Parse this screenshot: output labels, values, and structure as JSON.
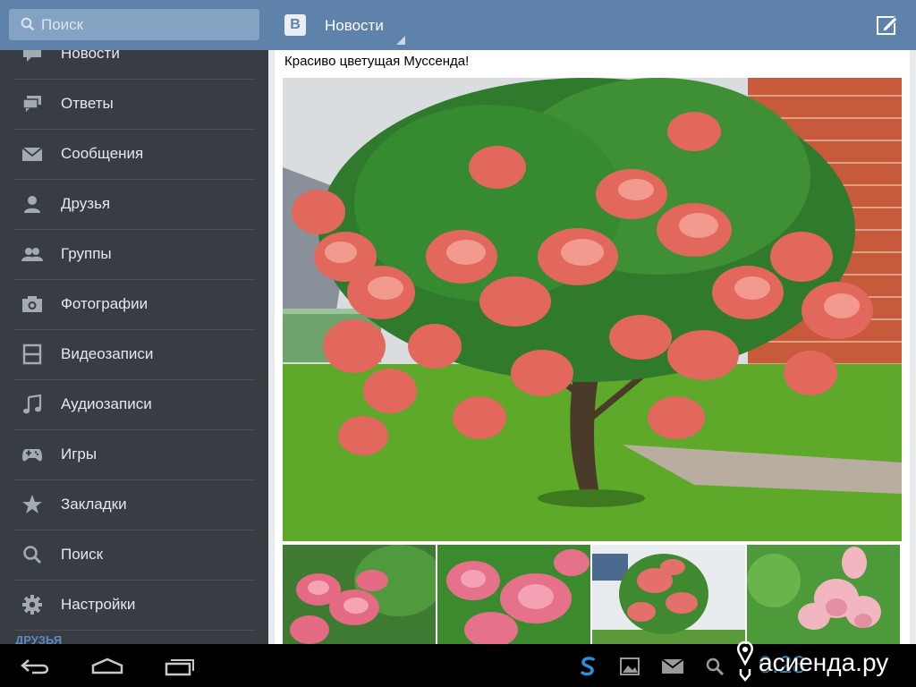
{
  "search": {
    "placeholder": "Поиск"
  },
  "header": {
    "logo_letter": "В",
    "title": "Новости"
  },
  "sidebar": {
    "items": [
      {
        "label": "Новости",
        "icon": "news-icon"
      },
      {
        "label": "Ответы",
        "icon": "replies-icon"
      },
      {
        "label": "Сообщения",
        "icon": "messages-icon"
      },
      {
        "label": "Друзья",
        "icon": "friends-icon"
      },
      {
        "label": "Группы",
        "icon": "groups-icon"
      },
      {
        "label": "Фотографии",
        "icon": "photos-icon"
      },
      {
        "label": "Видеозаписи",
        "icon": "video-icon"
      },
      {
        "label": "Аудиозаписи",
        "icon": "audio-icon"
      },
      {
        "label": "Игры",
        "icon": "games-icon"
      },
      {
        "label": "Закладки",
        "icon": "bookmarks-icon"
      },
      {
        "label": "Поиск",
        "icon": "search-icon"
      },
      {
        "label": "Настройки",
        "icon": "settings-icon"
      }
    ],
    "section_label": "ДРУЗЬЯ"
  },
  "post": {
    "text": "Красиво цветущая Муссенда!"
  },
  "status": {
    "clock": "0:28"
  },
  "watermark": {
    "text": "асиенда.ру"
  },
  "colors": {
    "topbar": "#5e82a9",
    "sidebar": "#383c43",
    "accent": "#5b8bc2"
  }
}
